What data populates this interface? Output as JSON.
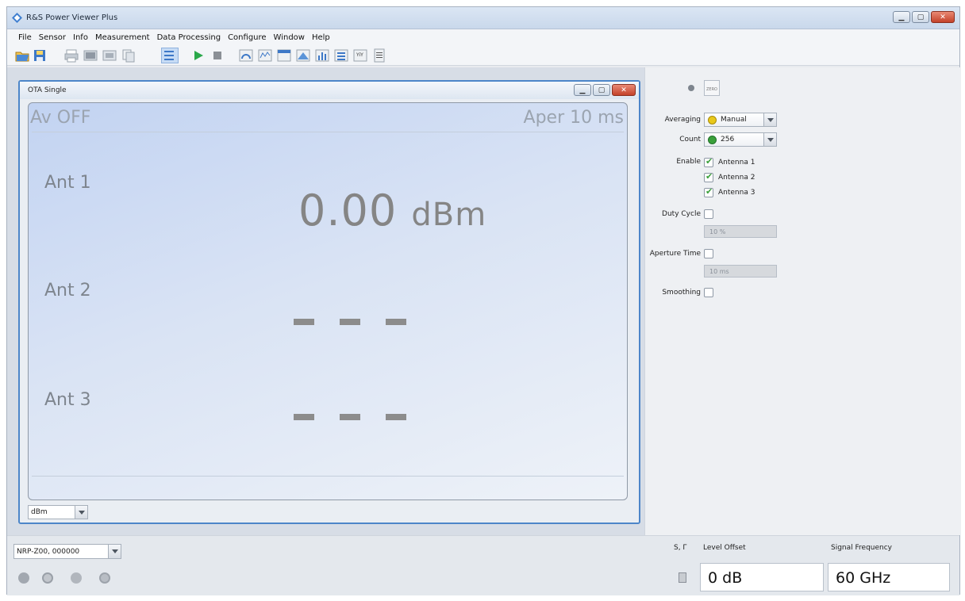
{
  "app": {
    "title": "R&S Power Viewer Plus"
  },
  "menu": [
    "File",
    "Sensor",
    "Info",
    "Measurement",
    "Data Processing",
    "Configure",
    "Window",
    "Help"
  ],
  "toolbar": {
    "icons": [
      "open-icon",
      "save-icon",
      "print-icon",
      "screenshot-icon",
      "export-icon",
      "copy-icon",
      "list-view-icon",
      "run-icon",
      "stop-icon",
      "gauge-icon",
      "trace-icon",
      "table-icon",
      "statistics-icon",
      "histogram-icon",
      "pulse-icon",
      "multi-channel-icon",
      "report-icon"
    ]
  },
  "child_window": {
    "title": "OTA Single",
    "header_left": "Av OFF",
    "header_right": "Aper 10 ms",
    "antennas": [
      {
        "label": "Ant 1",
        "value": "0.00",
        "unit": "dBm"
      },
      {
        "label": "Ant 2",
        "value": "- - -"
      },
      {
        "label": "Ant 3",
        "value": "- - -"
      }
    ],
    "unit_select": "dBm"
  },
  "side_panel": {
    "averaging_label": "Averaging",
    "averaging_value": "Manual",
    "count_label": "Count",
    "count_value": "256",
    "enable_label": "Enable",
    "antenna_options": [
      {
        "label": "Antenna 1",
        "checked": true
      },
      {
        "label": "Antenna 2",
        "checked": true
      },
      {
        "label": "Antenna 3",
        "checked": true
      }
    ],
    "duty_cycle_label": "Duty Cycle",
    "duty_cycle_value": "10 %",
    "aperture_time_label": "Aperture Time",
    "aperture_time_value": "10 ms",
    "smoothing_label": "Smoothing",
    "zero_label": "ZERO"
  },
  "bottom": {
    "sensor": "NRP-Z00, 000000",
    "s_gamma_label": "S, Γ",
    "level_offset_label": "Level Offset",
    "level_offset_value": "0 dB",
    "signal_frequency_label": "Signal Frequency",
    "signal_frequency_value": "60 GHz"
  },
  "colors": {
    "accent": "#4d86c9",
    "averaging_dot": "#e8c81a",
    "count_dot": "#3aa03a",
    "value_text": "#858585"
  }
}
